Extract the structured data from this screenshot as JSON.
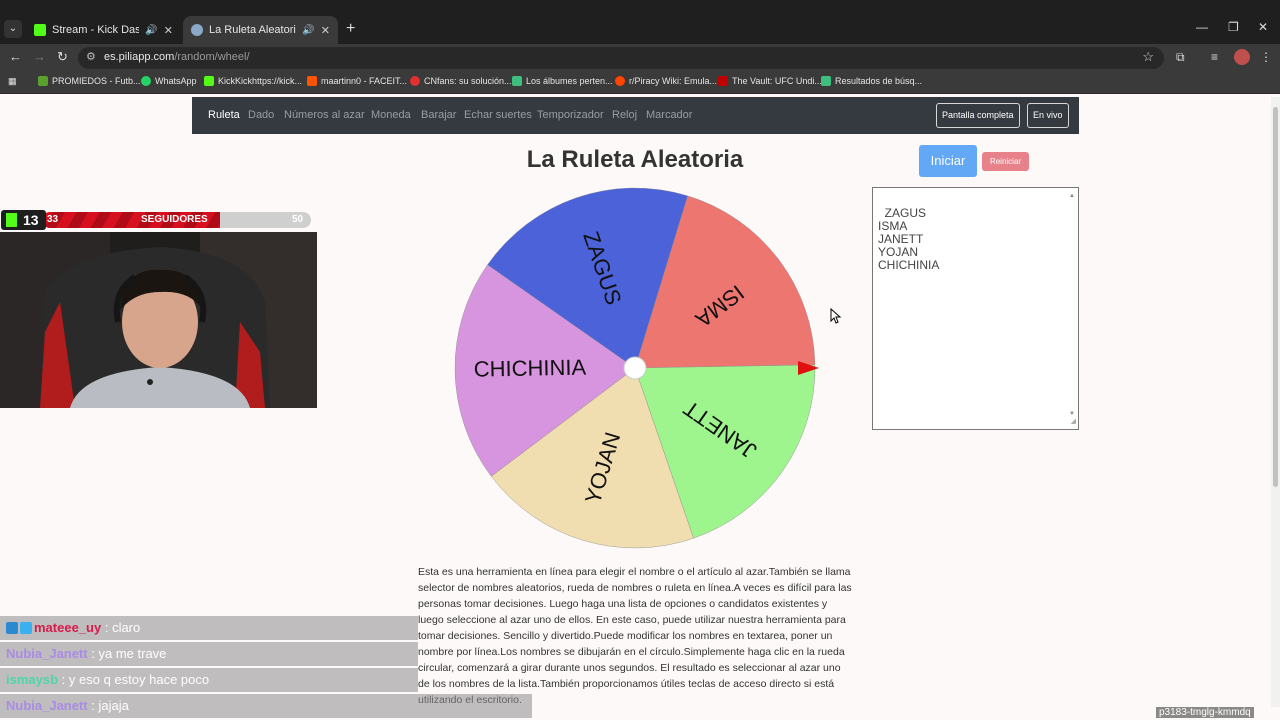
{
  "browser": {
    "tabs": [
      {
        "title": "Stream - Kick Dashboard",
        "favicon_color": "#53fc18",
        "active": false
      },
      {
        "title": "La Ruleta Aleatoria",
        "favicon_color": "#8aa8c8",
        "active": true
      }
    ],
    "url_host": "es.piliapp.com",
    "url_path": "/random/wheel/",
    "bookmarks": [
      {
        "label": "PROMIEDOS - Futb...",
        "icon_color": "#5aa02c"
      },
      {
        "label": "WhatsApp",
        "icon_color": "#25d366"
      },
      {
        "label": "KickKickhttps://kick...",
        "icon_color": "#53fc18"
      },
      {
        "label": "maartinn0 - FACEIT...",
        "icon_color": "#ff5500"
      },
      {
        "label": "CNfans: su solución...",
        "icon_color": "#e03030"
      },
      {
        "label": "Los álbumes perten...",
        "icon_color": "#3fbf7f"
      },
      {
        "label": "r/Piracy Wiki: Emula...",
        "icon_color": "#ff4500"
      },
      {
        "label": "The Vault: UFC Undi...",
        "icon_color": "#c00000"
      },
      {
        "label": "Resultados de búsq...",
        "icon_color": "#3fbf7f"
      }
    ]
  },
  "navbar": {
    "links": [
      "Ruleta",
      "Dado",
      "Números al azar",
      "Moneda",
      "Barajar",
      "Echar suertes",
      "Temporizador",
      "Reloj",
      "Marcador"
    ],
    "active": "Ruleta",
    "fullscreen_label": "Pantalla completa",
    "live_label": "En vivo"
  },
  "page": {
    "title": "La Ruleta Aleatoria",
    "start_label": "Iniciar",
    "reset_label": "Reiniciar",
    "names_text": "ZAGUS\nISMA\nJANETT\nYOJAN\nCHICHINIA",
    "description": "Esta es una herramienta en línea para elegir el nombre o el artículo al azar.También se llama selector de nombres aleatorios, rueda de nombres o ruleta en línea.A veces es difícil para las personas tomar decisiones. Luego haga una lista de opciones o candidatos existentes y luego seleccione al azar uno de ellos. En este caso, puede utilizar nuestra herramienta para tomar decisiones. Sencillo y divertido.Puede modificar los nombres en textarea, poner un nombre por línea.Los nombres se dibujarán en el círculo.Simplemente haga clic en la rueda circular, comenzará a girar durante unos segundos. El resultado es seleccionar al azar uno de los nombres de la lista.También proporcionamos útiles teclas de acceso directo si está utilizando el escritorio."
  },
  "wheel": {
    "segments": [
      {
        "name": "ISMA",
        "color": "#ee7671"
      },
      {
        "name": "JANETT",
        "color": "#9ef58e"
      },
      {
        "name": "YOJAN",
        "color": "#f1deb0"
      },
      {
        "name": "CHICHINIA",
        "color": "#d895df"
      },
      {
        "name": "ZAGUS",
        "color": "#4b62d8"
      }
    ],
    "pointer_color": "#e01010"
  },
  "overlay": {
    "kick_count": "13",
    "followers_current": "33",
    "followers_label": "SEGUIDORES",
    "followers_goal": "50",
    "progress_fraction": 0.66,
    "chat": [
      {
        "user": "mateee_uy",
        "message": ": claro",
        "badges": true
      },
      {
        "user": "Nubia_Janett",
        "message": ": ya me trave",
        "badges": false
      },
      {
        "user": "ismaysb",
        "message": ": y eso q estoy hace poco",
        "badges": false
      },
      {
        "user": "Nubia_Janett",
        "message": ": jajaja",
        "badges": false
      }
    ],
    "stream_id": "p3183-tmglg-kmmdq"
  }
}
